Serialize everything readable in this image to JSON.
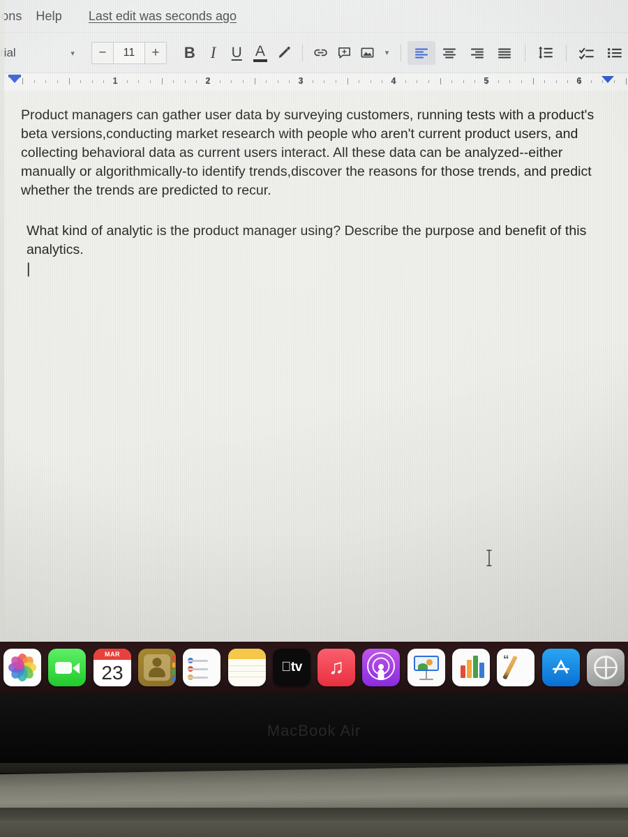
{
  "app": {
    "name": "Google Docs",
    "device": "MacBook Air"
  },
  "menubar": {
    "items": [
      {
        "label": "-ons",
        "name": "menu-add-ons"
      },
      {
        "label": "Help",
        "name": "menu-help"
      }
    ],
    "doc_status": "Last edit was seconds ago"
  },
  "toolbar": {
    "font_family": "rial",
    "font_family_caret": "▾",
    "font_size_decrease": "−",
    "font_size_value": "11",
    "font_size_increase": "+",
    "bold": "B",
    "italic": "I",
    "underline": "U",
    "text_color": "A",
    "highlight_icon": "highlighter-icon",
    "insert_link_icon": "link-icon",
    "add_comment_icon": "comment-icon",
    "insert_image_icon": "image-icon",
    "insert_image_caret": "▾",
    "align_left_icon": "align-left-icon",
    "align_center_icon": "align-center-icon",
    "align_right_icon": "align-right-icon",
    "align_justify_icon": "align-justify-icon",
    "line_spacing_icon": "line-spacing-icon",
    "checklist_icon": "checklist-icon",
    "bulleted_list_icon": "bulleted-list-icon",
    "active_alignment": "align-left",
    "accent_color": "#2f5bd7",
    "active_bg_color": "#dadce0"
  },
  "ruler": {
    "numbers": [
      "1",
      "2",
      "3",
      "4",
      "5",
      "6"
    ],
    "left_indent_marker": "left-indent-marker",
    "right_indent_marker": "right-indent-marker",
    "marker_color": "#2f5bd7"
  },
  "document": {
    "paragraph_1": "Product managers can gather user data by surveying customers, running tests with a product's beta versions,conducting market research with people who aren't current product users, and collecting behavioral data as current users interact. All these data can be analyzed--either manually or algorithmically-to identify trends,discover the reasons for those trends, and predict whether the trends are predicted to recur.",
    "paragraph_2": "What kind of analytic is the product manager using? Describe the purpose and benefit of this analytics.",
    "caret": "|",
    "page_bg_color": "#eeeeea",
    "text_color": "#1b1b1b",
    "mouse_cursor": "i-beam-cursor"
  },
  "dock": {
    "items": [
      {
        "name": "dock-photos",
        "label": "Photos"
      },
      {
        "name": "dock-facetime",
        "label": "FaceTime"
      },
      {
        "name": "dock-calendar",
        "label": "Calendar",
        "month": "MAR",
        "day": "23"
      },
      {
        "name": "dock-contacts",
        "label": "Contacts"
      },
      {
        "name": "dock-reminders",
        "label": "Reminders"
      },
      {
        "name": "dock-notes",
        "label": "Notes",
        "running": true
      },
      {
        "name": "dock-apple-tv",
        "label": "tv"
      },
      {
        "name": "dock-music",
        "label": "Music"
      },
      {
        "name": "dock-podcasts",
        "label": "Podcasts"
      },
      {
        "name": "dock-keynote",
        "label": "Keynote"
      },
      {
        "name": "dock-numbers",
        "label": "Numbers"
      },
      {
        "name": "dock-pages",
        "label": "Pages",
        "running": true
      },
      {
        "name": "dock-app-store",
        "label": "App Store"
      },
      {
        "name": "dock-system-preferences",
        "label": "System Preferences",
        "running": true
      }
    ],
    "background_color": "#2a1416"
  },
  "bezel": {
    "logo_text": "MacBook Air"
  }
}
